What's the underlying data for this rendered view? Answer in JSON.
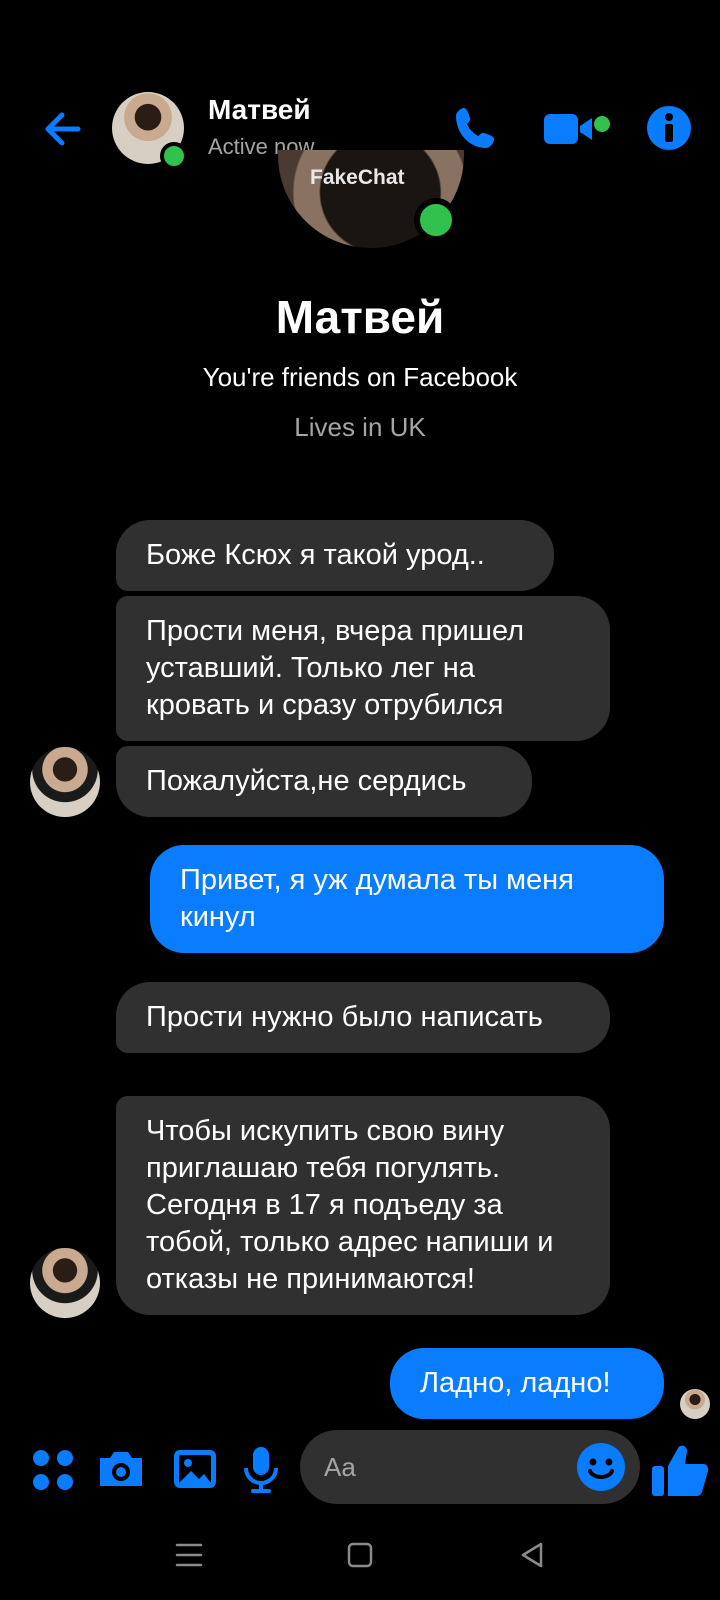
{
  "header": {
    "contact_name": "Матвей",
    "status": "Active now"
  },
  "watermark": "FakeChat",
  "profile": {
    "name": "Матвей",
    "friends_text": "You're friends on Facebook",
    "lives_text": "Lives in UK"
  },
  "messages": [
    {
      "direction": "incoming",
      "text": "Боже Ксюх я такой урод.."
    },
    {
      "direction": "incoming",
      "text": "Прости меня, вчера пришел уставший. Только лег на кровать и сразу отрубился"
    },
    {
      "direction": "incoming",
      "text": "Пожалуйста,не сердись"
    },
    {
      "direction": "outgoing",
      "text": "Привет, я уж думала ты меня кинул"
    },
    {
      "direction": "incoming",
      "text": "Прости нужно было написать"
    },
    {
      "direction": "incoming",
      "text": "Чтобы искупить свою вину приглашаю тебя погулять. Сегодня в 17 я подъеду за тобой, только адрес напиши и отказы не принимаются!"
    },
    {
      "direction": "outgoing",
      "text": "Ладно, ладно!"
    }
  ],
  "composer": {
    "placeholder": "Aa"
  },
  "icons": {
    "back": "arrow-left-icon",
    "call": "phone-icon",
    "video": "video-camera-icon",
    "info": "info-icon",
    "apps": "four-dots-icon",
    "camera": "camera-icon",
    "gallery": "image-icon",
    "mic": "microphone-icon",
    "emoji": "smiley-icon",
    "like": "thumbs-up-icon"
  },
  "colors": {
    "accent": "#0a7cff",
    "incoming_bubble": "#303030",
    "online": "#31c24d",
    "background": "#000000"
  }
}
